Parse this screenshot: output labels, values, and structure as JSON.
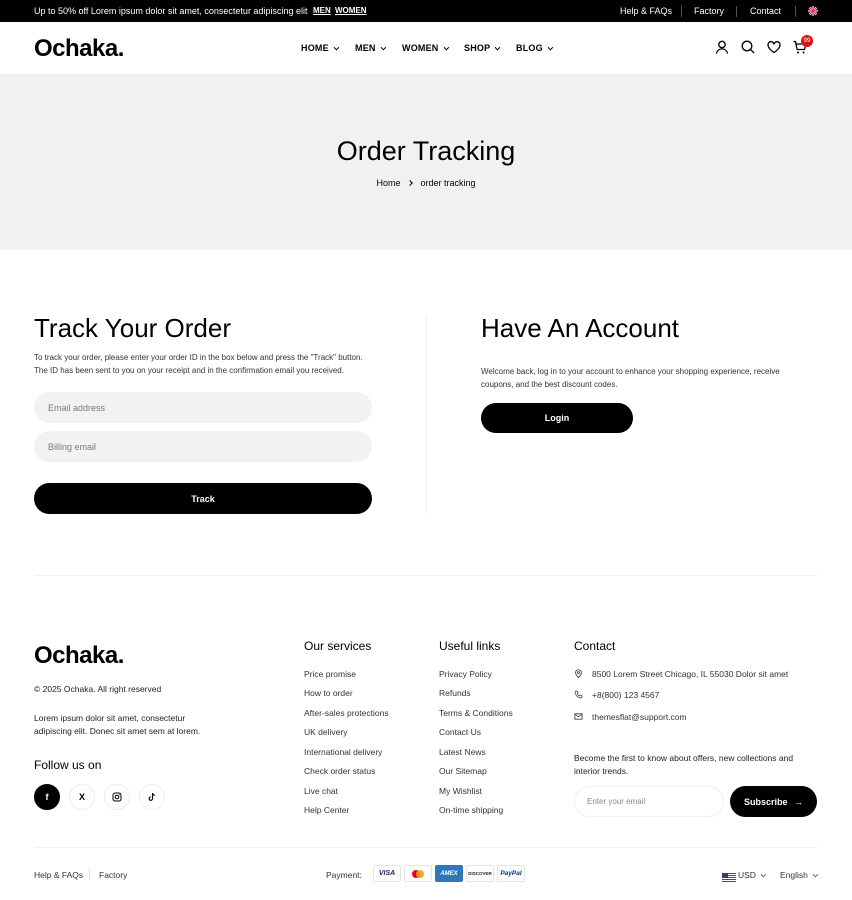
{
  "topbar": {
    "promo": "Up to 50% off Lorem ipsum dolor sit amet, consectetur adipiscing elit",
    "link_men": "MEN",
    "link_women": "WOMEN",
    "help": "Help & FAQs",
    "factory": "Factory",
    "contact": "Contact"
  },
  "header": {
    "logo": "Ochaka.",
    "nav": [
      "HOME",
      "MEN",
      "WOMEN",
      "SHOP",
      "BLOG"
    ],
    "cart_count": "99"
  },
  "hero": {
    "title": "Order Tracking",
    "breadcrumb": [
      "Home",
      "order tracking"
    ]
  },
  "track": {
    "title": "Track Your Order",
    "description": "To track your order, please enter your order ID in the box below and press the \"Track\" button. The ID has been sent to you on your receipt and in the confirmation email you received.",
    "email_placeholder": "Email address",
    "billing_placeholder": "Billing email",
    "button": "Track"
  },
  "account": {
    "title": "Have An Account",
    "description": "Welcome back, log in to your account to enhance your shopping experience, receive coupons, and the best discount codes.",
    "button": "Login"
  },
  "footer": {
    "logo": "Ochaka.",
    "copyright": "© 2025 Ochaka. All right reserved",
    "about": "Lorem ipsum dolor sit amet, consectetur adipiscing elit. Donec sit amet sem at lorem.",
    "follow": "Follow us on",
    "socials": [
      "f",
      "X",
      "ig",
      "tt"
    ],
    "services_title": "Our services",
    "services": [
      "Price promise",
      "How to order",
      "After-sales protections",
      "UK delivery",
      "International delivery",
      "Check order status",
      "Live chat",
      "Help Center"
    ],
    "links_title": "Useful links",
    "links": [
      "Privacy Policy",
      "Refunds",
      "Terms & Conditions",
      "Contact Us",
      "Latest News",
      "Our Sitemap",
      "My Wishlist",
      "On-time shipping"
    ],
    "contact_title": "Contact",
    "address": "8500 Lorem Street   Chicago, IL 55030 Dolor sit amet",
    "phone": "+8(800) 123 4567",
    "email": "themesflat@support.com",
    "newsletter": "Become the first to know about offers, new collections and interior trends.",
    "subscribe_placeholder": "Enter your email",
    "subscribe_button": "Subscribe"
  },
  "bottom": {
    "help": "Help & FAQs",
    "factory": "Factory",
    "payment_label": "Payment:",
    "payments": [
      "VISA",
      "MC",
      "AMEX",
      "DISCOVER",
      "PayPal"
    ],
    "currency": "USD",
    "language": "English"
  }
}
